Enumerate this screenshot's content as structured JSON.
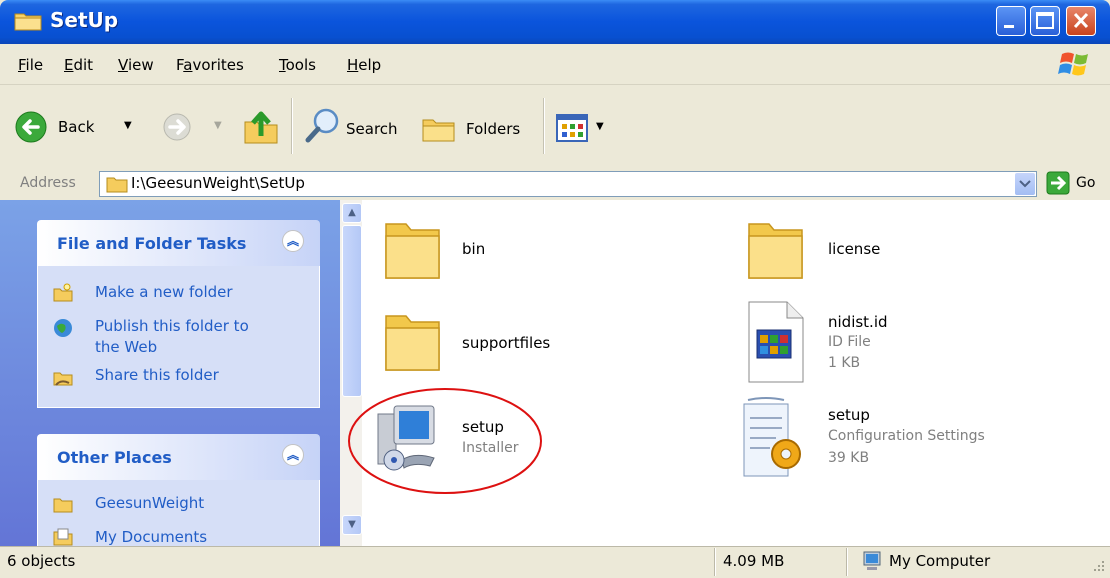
{
  "window": {
    "title": "SetUp"
  },
  "menu": [
    {
      "pre": "",
      "u": "F",
      "post": "ile"
    },
    {
      "pre": "",
      "u": "E",
      "post": "dit"
    },
    {
      "pre": "",
      "u": "V",
      "post": "iew"
    },
    {
      "pre": "F",
      "u": "a",
      "post": "vorites"
    },
    {
      "pre": "",
      "u": "T",
      "post": "ools"
    },
    {
      "pre": "",
      "u": "H",
      "post": "elp"
    }
  ],
  "toolbar": {
    "back_label": "Back",
    "search_label": "Search",
    "folders_label": "Folders"
  },
  "address": {
    "label": "Address",
    "value": "I:\\GeesunWeight\\SetUp",
    "go_label": "Go"
  },
  "tasks_panel": {
    "title": "File and Folder Tasks",
    "items": [
      "Make a new folder",
      "Publish this folder to",
      "the Web",
      "Share this folder"
    ]
  },
  "places_panel": {
    "title": "Other Places",
    "items": [
      "GeesunWeight",
      "My Documents"
    ]
  },
  "files": [
    {
      "name": "bin"
    },
    {
      "name": "license"
    },
    {
      "name": "supportfiles"
    },
    {
      "name": "nidist.id",
      "type": "ID File",
      "size": "1 KB"
    },
    {
      "name": "setup",
      "type": "Installer"
    },
    {
      "name": "setup",
      "type": "Configuration Settings",
      "size": "39 KB"
    }
  ],
  "status": {
    "objects": "6 objects",
    "size": "4.09 MB",
    "location": "My Computer"
  },
  "colors": {
    "titlebar": "#0a54dc",
    "task_link": "#215dc6",
    "highlight_circle": "#dd1111"
  }
}
